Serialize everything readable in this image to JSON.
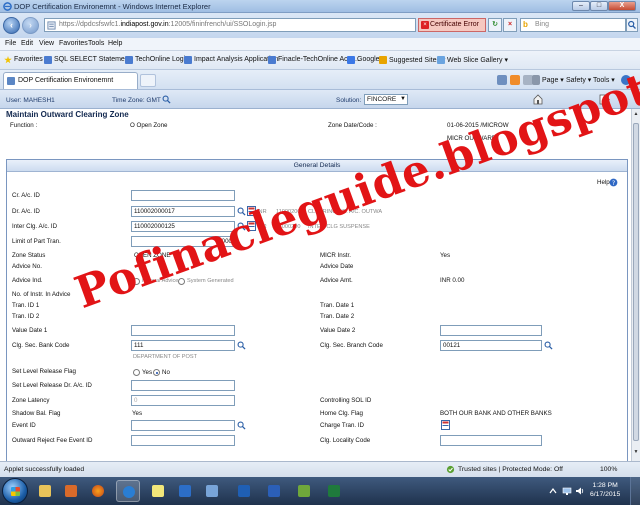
{
  "window": {
    "title": "DOP Certification Environemnt - Windows Internet Explorer",
    "buttons": {
      "minimize": "–",
      "maximize": "□",
      "close": "X"
    }
  },
  "address_bar": {
    "url_prefix": "https://dpdcsfswfc1.",
    "url_host": "indiapost.gov.in",
    "url_suffix": ":12005/fininfrench/ui/SSOLogin.jsp",
    "cert_error": "Certificate Error",
    "search_placeholder": "Bing"
  },
  "menu": [
    "File",
    "Edit",
    "View",
    "Favorites",
    "Tools",
    "Help"
  ],
  "favorites_bar": {
    "label": "Favorites",
    "items": [
      "SQL SELECT Statement",
      "TechOnline Login",
      "Impact Analysis Application",
      "Finacle-TechOnline Acce...",
      "Google",
      "Suggested Sites ▾",
      "Web Slice Gallery ▾"
    ]
  },
  "tab": {
    "title": "DOP Certification Environemnt"
  },
  "commands": [
    "Page ▾",
    "Safety ▾",
    "Tools ▾"
  ],
  "app_header": {
    "user_label": "User: MAHESH1",
    "time_zone_label": "Time Zone: GMT",
    "solution_label": "Solution:",
    "solution_value": "FINCORE"
  },
  "form": {
    "title": "Maintain Outward Clearing Zone",
    "function_label": "Function :",
    "function_value": "O  Open Zone",
    "zone_date_label": "Zone Date/Code :",
    "zone_date_value": "01-06-2015 /MICROW",
    "zone_code_desc": "MICR OUTWARD",
    "section_title": "General Details",
    "help_label": "Help",
    "cr_ac_id_label": "Cr. A/c. ID",
    "cr_ac_id_value": "",
    "dr_ac_id_label": "Dr. A/c. ID",
    "dr_ac_id_value": "110002000017",
    "dr_currency": "INR",
    "dr_sol": "11000200",
    "dr_desc": "CLEARING DR. A/C. OUTWA",
    "inter_clg_label": "Inter Clg. A/c. ID",
    "inter_clg_value": "110002000125",
    "inter_currency": "INR",
    "inter_sol": "11000200",
    "inter_desc": "INTER CLG SUSPENSE",
    "limit_label": "Limit of Part Tran.",
    "limit_value": "1000",
    "zone_status_label": "Zone Status",
    "zone_status_value": "OPEN ZONE",
    "micr_instr_label": "MICR Instr.",
    "micr_instr_value": "Yes",
    "advice_no_label": "Advice No.",
    "advice_date_label": "Advice Date",
    "advice_ind_label": "Advice Ind.",
    "advice_ind_opt1": "Manual Advice",
    "advice_ind_opt2": "System Generated",
    "advice_amt_label": "Advice Amt.",
    "advice_amt_value": "INR  0.00",
    "no_instr_label": "No. of Instr. In Advice",
    "tran_id1_label": "Tran. ID 1",
    "tran_date1_label": "Tran. Date 1",
    "tran_id2_label": "Tran. ID 2",
    "tran_date2_label": "Tran. Date 2",
    "value_date1_label": "Value Date 1",
    "value_date2_label": "Value Date 2",
    "clg_bank_label": "Clg. Sec. Bank Code",
    "clg_bank_value": "111",
    "clg_bank_desc": "DEPARTMENT OF POST",
    "clg_branch_label": "Clg. Sec. Branch Code",
    "clg_branch_value": "00121",
    "set_level_flag_label": "Set Level Release Flag",
    "set_level_yes": "Yes",
    "set_level_no": "No",
    "set_level_dr_label": "Set Level Release Dr. A/c. ID",
    "zone_latency_label": "Zone Latency",
    "zone_latency_value": "0",
    "controlling_sol_label": "Controlling SOL ID",
    "shadow_bal_label": "Shadow Bal. Flag",
    "shadow_bal_value": "Yes",
    "home_clg_label": "Home Clg. Flag",
    "home_clg_value": "BOTH OUR BANK AND OTHER BANKS",
    "event_id_label": "Event ID",
    "charge_tran_label": "Charge Tran. ID",
    "outward_reject_label": "Outward Reject Fee Event ID",
    "clg_locality_label": "Clg. Locality Code"
  },
  "watermark": "Pofinacleguide.blogspot.in",
  "status_bar": {
    "left": "Applet successfully loaded",
    "zone": "Trusted sites | Protected Mode: Off",
    "zoom": "100%"
  },
  "taskbar": {
    "time": "1:28 PM",
    "date": "6/17/2015"
  },
  "colors": {
    "accent": "#1e3a6b",
    "watermark": "#e21416",
    "taskbar": "#1f324d"
  }
}
